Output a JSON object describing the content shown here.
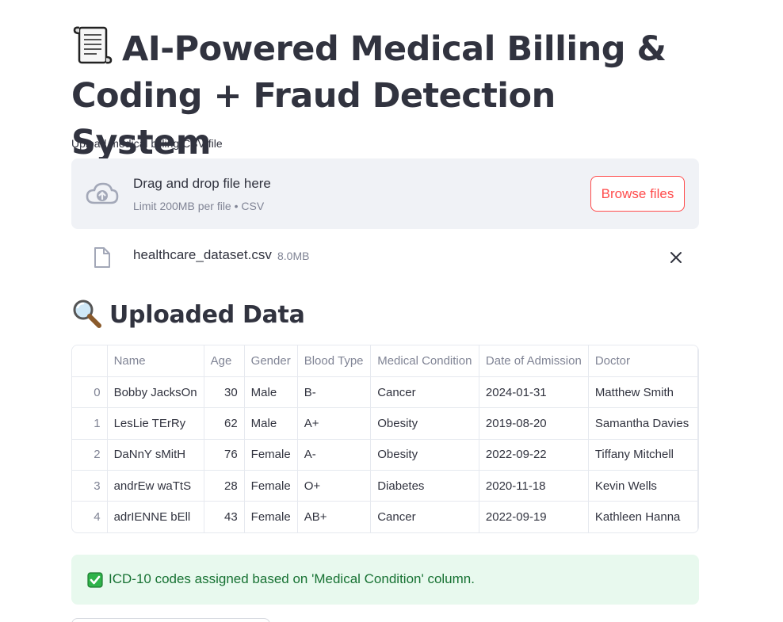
{
  "header": {
    "title": "AI-Powered Medical Billing & Coding + Fraud Detection System",
    "title_icon": "scroll-icon"
  },
  "uploader": {
    "label": "Upload medical billing CSV file",
    "drop_text": "Drag and drop file here",
    "limit_text": "Limit 200MB per file • CSV",
    "browse_label": "Browse files"
  },
  "file": {
    "name": "healthcare_dataset.csv",
    "size": "8.0MB"
  },
  "uploaded_section": {
    "title": "Uploaded Data",
    "icon": "magnifying-glass-icon"
  },
  "table": {
    "columns": [
      "",
      "Name",
      "Age",
      "Gender",
      "Blood Type",
      "Medical Condition",
      "Date of Admission",
      "Doctor"
    ],
    "rows": [
      [
        "0",
        "Bobby JacksOn",
        "30",
        "Male",
        "B-",
        "Cancer",
        "2024-01-31",
        "Matthew Smith"
      ],
      [
        "1",
        "LesLie TErRy",
        "62",
        "Male",
        "A+",
        "Obesity",
        "2019-08-20",
        "Samantha Davies"
      ],
      [
        "2",
        "DaNnY sMitH",
        "76",
        "Female",
        "A-",
        "Obesity",
        "2022-09-22",
        "Tiffany Mitchell"
      ],
      [
        "3",
        "andrEw waTtS",
        "28",
        "Female",
        "O+",
        "Diabetes",
        "2020-11-18",
        "Kevin Wells"
      ],
      [
        "4",
        "adrIENNE bEll",
        "43",
        "Female",
        "AB+",
        "Cancer",
        "2022-09-19",
        "Kathleen Hanna"
      ]
    ]
  },
  "alert": {
    "message": "ICD-10 codes assigned based on 'Medical Condition' column.",
    "color": "#177233",
    "background": "#e8f9ee"
  },
  "colors": {
    "accent": "#ff4b4b",
    "text": "#31333f",
    "muted": "#808495"
  }
}
